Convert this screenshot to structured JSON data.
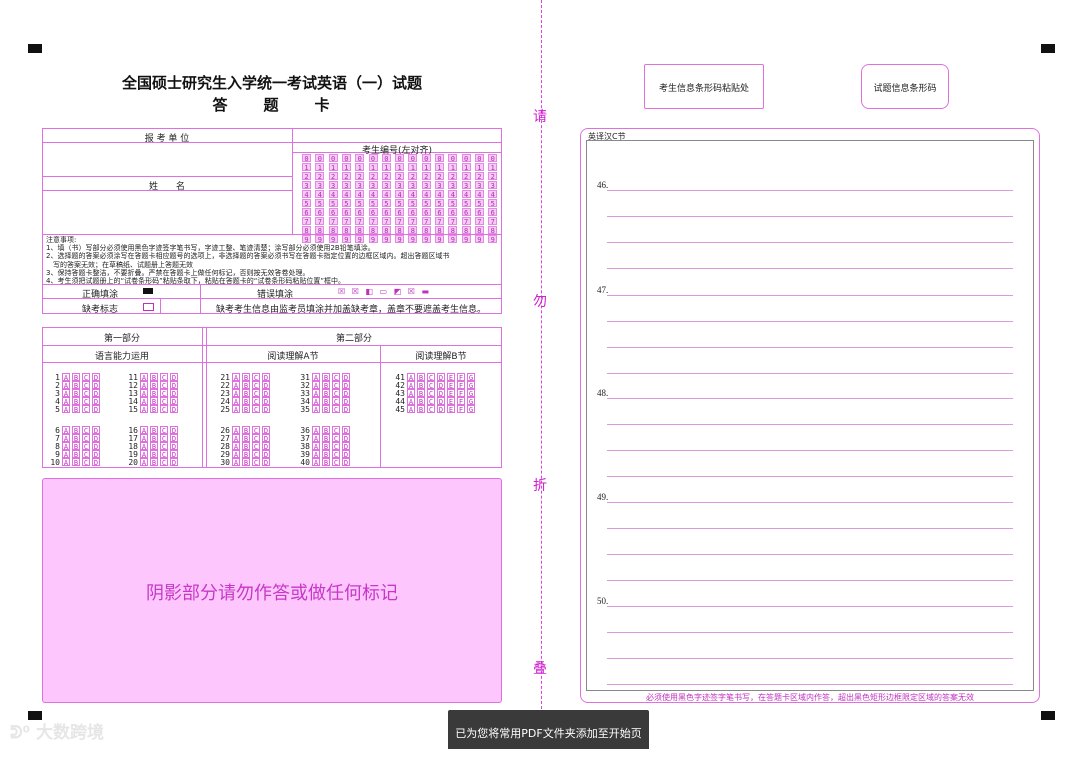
{
  "header": {
    "title": "全国硕士研究生入学统一考试英语（一）试题",
    "subtitle": "答　　题　　卡"
  },
  "barcodes": {
    "examinee": "考生信息条形码粘贴处",
    "paper": "试题信息条形码"
  },
  "fold_text": [
    "请",
    "勿",
    "折",
    "叠"
  ],
  "info": {
    "unit_label": "报 考 单 位",
    "name_label": "姓　　名",
    "exam_id_label": "考生编号(左对齐)",
    "digits": [
      "0",
      "1",
      "2",
      "3",
      "4",
      "5",
      "6",
      "7",
      "8",
      "9"
    ],
    "digit_columns": 15
  },
  "notes": {
    "heading": "注意事项:",
    "lines": [
      "1、填（书）写部分必须使用黑色字迹签字笔书写，字迹工整、笔迹清楚；涂写部分必须使用2B铅笔填涂。",
      "2、选择题的答案必须涂写在答题卡相应题号的选项上，非选择题的答案必须书写在答题卡指定位置的边框区域内。超出答题区域书",
      "　写的答案无效；在草稿纸、试题册上答题无效",
      "3、保持答题卡整洁，不要折叠。严禁在答题卡上做任何标记，否则按无效答卷处理。",
      "4、考生须把试题册上的“试卷条形码”粘贴条取下，粘贴在答题卡的“试卷条形码粘贴位置”框中。"
    ]
  },
  "fill": {
    "correct_label": "正确填涂",
    "wrong_label": "错误填涂",
    "absent_label": "缺考标志",
    "absent_note": "缺考考生信息由监考员填涂并加盖缺考章，盖章不要遮盖考生信息。"
  },
  "parts": {
    "part1": "第一部分",
    "part2": "第二部分",
    "sec_lang": "语言能力运用",
    "sec_a": "阅读理解A节",
    "sec_b": "阅读理解B节"
  },
  "questions": {
    "abcd": [
      "A",
      "B",
      "C",
      "D"
    ],
    "abcdefg": [
      "A",
      "B",
      "C",
      "D",
      "E",
      "F",
      "G"
    ],
    "col1": [
      1,
      2,
      3,
      4,
      5,
      6,
      7,
      8,
      9,
      10
    ],
    "col2": [
      11,
      12,
      13,
      14,
      15,
      16,
      17,
      18,
      19,
      20
    ],
    "col3": [
      21,
      22,
      23,
      24,
      25,
      26,
      27,
      28,
      29,
      30
    ],
    "col4": [
      31,
      32,
      33,
      34,
      35,
      36,
      37,
      38,
      39,
      40
    ],
    "col5": [
      41,
      42,
      43,
      44,
      45
    ]
  },
  "shade_text": "阴影部分请勿作答或做任何标记",
  "right": {
    "section_title": "英译汉C节",
    "items": [
      "46.",
      "47.",
      "48.",
      "49.",
      "50."
    ],
    "footer": "必须使用黑色字迹签字笔书写，在答题卡区域内作答，超出黑色矩形边框限定区域的答案无效"
  },
  "toast": "已为您将常用PDF文件夹添加至开始页",
  "watermark": "大数跨境"
}
